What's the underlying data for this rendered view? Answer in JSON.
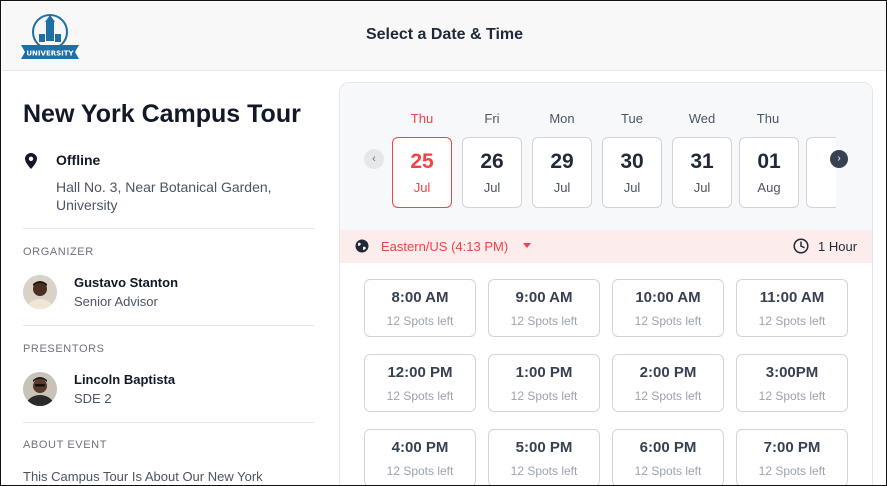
{
  "header": {
    "logo_text": "UNIVERSITY",
    "title": "Select a Date & Time"
  },
  "event": {
    "title": "New York Campus Tour",
    "location_type": "Offline",
    "location_address": "Hall No. 3, Near Botanical Garden, University"
  },
  "organizer": {
    "section_label": "ORGANIZER",
    "name": "Gustavo Stanton",
    "role": "Senior Advisor"
  },
  "presentors": {
    "section_label": "PRESENTORS",
    "name": "Lincoln Baptista",
    "role": "SDE 2"
  },
  "about": {
    "section_label": "ABOUT EVENT",
    "text": "This Campus Tour Is About Our New York"
  },
  "dates": [
    {
      "dow": "Thu",
      "day": "25",
      "month": "Jul",
      "selected": true
    },
    {
      "dow": "Fri",
      "day": "26",
      "month": "Jul",
      "selected": false
    },
    {
      "dow": "Mon",
      "day": "29",
      "month": "Jul",
      "selected": false
    },
    {
      "dow": "Tue",
      "day": "30",
      "month": "Jul",
      "selected": false
    },
    {
      "dow": "Wed",
      "day": "31",
      "month": "Jul",
      "selected": false
    },
    {
      "dow": "Thu",
      "day": "01",
      "month": "Aug",
      "selected": false
    }
  ],
  "nav": {
    "prev": "‹",
    "next": "›"
  },
  "timezone": {
    "label": "Eastern/US (4:13 PM)",
    "duration": "1 Hour"
  },
  "slots": [
    {
      "time": "8:00 AM",
      "spots": "12 Spots left"
    },
    {
      "time": "9:00 AM",
      "spots": "12 Spots left"
    },
    {
      "time": "10:00 AM",
      "spots": "12 Spots left"
    },
    {
      "time": "11:00 AM",
      "spots": "12 Spots left"
    },
    {
      "time": "12:00 PM",
      "spots": "12 Spots left"
    },
    {
      "time": "1:00 PM",
      "spots": "12 Spots left"
    },
    {
      "time": "2:00 PM",
      "spots": "12 Spots left"
    },
    {
      "time": "3:00PM",
      "spots": "12 Spots left"
    },
    {
      "time": "4:00 PM",
      "spots": "12 Spots left"
    },
    {
      "time": "5:00 PM",
      "spots": "12 Spots left"
    },
    {
      "time": "6:00 PM",
      "spots": "12 Spots left"
    },
    {
      "time": "7:00 PM",
      "spots": "12 Spots left"
    }
  ],
  "colors": {
    "accent": "#ef4444",
    "brand": "#1d6fa5",
    "timezone_bar": "#fdecec"
  }
}
